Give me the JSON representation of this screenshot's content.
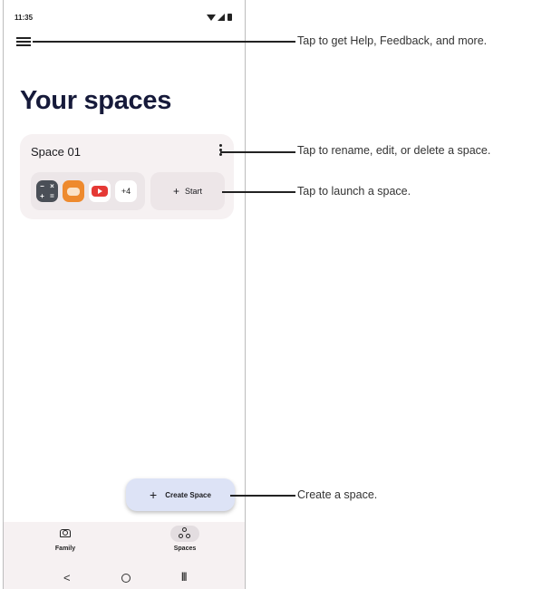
{
  "status_bar": {
    "time": "11:35"
  },
  "header": {
    "title": "Your spaces"
  },
  "space_card": {
    "name": "Space 01",
    "apps": [
      "calculator-icon",
      "game-controller-icon",
      "youtube-icon"
    ],
    "more_count": "+4",
    "start_label": "Start"
  },
  "fab": {
    "label": "Create Space"
  },
  "bottom_nav": {
    "items": [
      {
        "label": "Family",
        "icon": "family-icon"
      },
      {
        "label": "Spaces",
        "icon": "spaces-icon",
        "selected": true
      }
    ]
  },
  "annotations": {
    "menu": "Tap to get Help, Feedback, and more.",
    "kebab": "Tap to rename, edit, or delete a space.",
    "start": "Tap to launch a space.",
    "create": "Create a space."
  }
}
